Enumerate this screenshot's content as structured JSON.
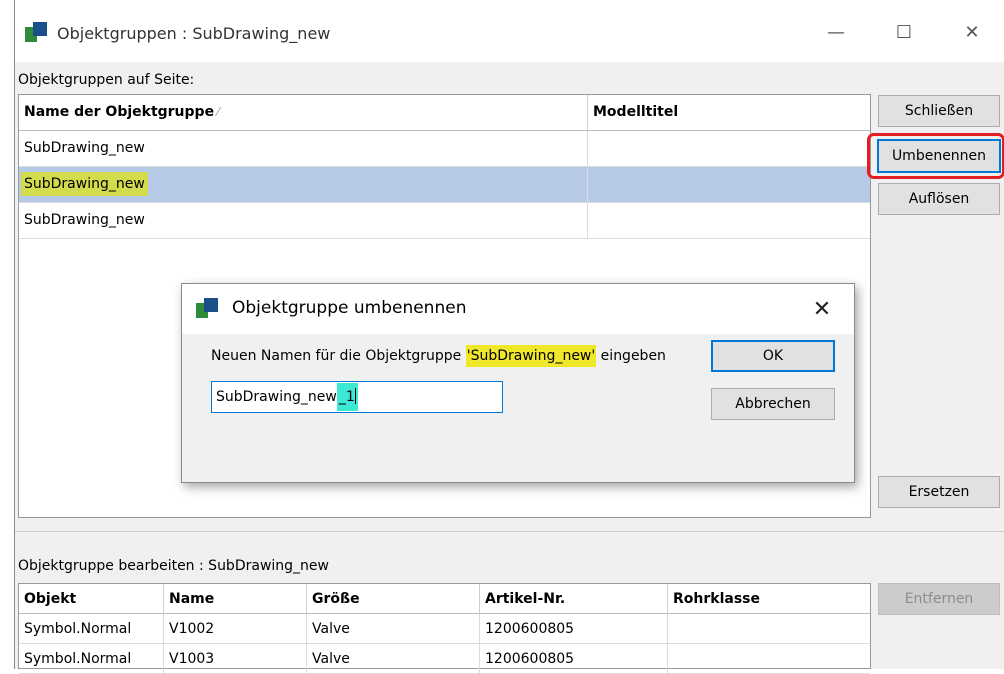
{
  "window": {
    "title": "Objektgruppen : SubDrawing_new"
  },
  "groups_panel": {
    "label": "Objektgruppen auf Seite:",
    "columns": [
      "Name der Objektgruppe",
      "Modelltitel"
    ],
    "sort_indicator": "⁄",
    "rows": [
      {
        "name": "SubDrawing_new",
        "title": "",
        "selected": false
      },
      {
        "name": "SubDrawing_new",
        "title": "",
        "selected": true
      },
      {
        "name": "SubDrawing_new",
        "title": "",
        "selected": false
      }
    ]
  },
  "buttons": {
    "close": "Schließen",
    "rename": "Umbenennen",
    "dissolve": "Auflösen",
    "replace": "Ersetzen",
    "remove": "Entfernen"
  },
  "dialog": {
    "title": "Objektgruppe umbenennen",
    "prompt_prefix": "Neuen Namen für die Objektgruppe ",
    "prompt_name": "'SubDrawing_new'",
    "prompt_suffix": " eingeben",
    "input_value_base": "SubDrawing_new",
    "input_value_added": "_1",
    "ok": "OK",
    "cancel": "Abbrechen"
  },
  "edit_panel": {
    "label": "Objektgruppe bearbeiten : SubDrawing_new",
    "columns": [
      "Objekt",
      "Name",
      "Größe",
      "Artikel-Nr.",
      "Rohrklasse"
    ],
    "rows": [
      [
        "Symbol.Normal",
        "V1002",
        "Valve",
        "1200600805",
        ""
      ],
      [
        "Symbol.Normal",
        "V1003",
        "Valve",
        "1200600805",
        ""
      ]
    ]
  },
  "colors": {
    "selection": "#b6c9e6",
    "highlight_yellow": "#d3dc4c",
    "highlight_cyan": "#3de8d4",
    "focus_blue": "#0078d7",
    "annotation_red": "#e41d22"
  },
  "icons": [
    "app-icon",
    "minimize-icon",
    "maximize-icon",
    "close-icon"
  ]
}
